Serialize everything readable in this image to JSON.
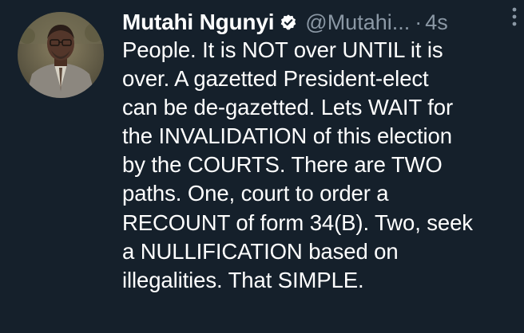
{
  "tweet": {
    "display_name": "Mutahi Ngunyi",
    "handle": "@Mutahi...",
    "separator": "·",
    "timestamp": "4s",
    "verified_icon": "verified-badge-icon",
    "more_icon": "more-vertical-icon",
    "body_lines": [
      "People. It is NOT over UNTIL it is",
      "over. A gazetted President-elect",
      "can be de-gazetted. Lets WAIT for",
      "the INVALIDATION of this election",
      "by the COURTS. There are TWO",
      "paths. One, court to order a",
      "RECOUNT of form 34(B). Two, seek",
      "a NULLIFICATION based on",
      "illegalities. That SIMPLE."
    ]
  },
  "colors": {
    "background": "#15202b",
    "text": "#ffffff",
    "secondary_text": "#8b98a5"
  }
}
